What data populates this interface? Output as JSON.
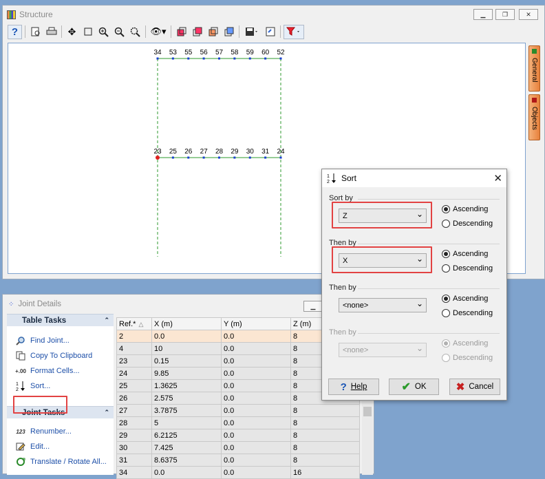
{
  "structure": {
    "title": "Structure",
    "top_labels": [
      "34",
      "53",
      "55",
      "56",
      "57",
      "58",
      "59",
      "60",
      "52"
    ],
    "mid_labels": [
      "23",
      "25",
      "26",
      "27",
      "28",
      "29",
      "30",
      "31",
      "24"
    ],
    "side_tabs": [
      "General",
      "Objects"
    ]
  },
  "joint": {
    "title": "Joint Details",
    "table_tasks_header": "Table Tasks",
    "table_tasks": [
      {
        "label": "Find Joint...",
        "icon": "magnifier-icon"
      },
      {
        "label": "Copy To Clipboard",
        "icon": "copy-icon"
      },
      {
        "label": "Format Cells...",
        "icon": "format-cells-icon"
      },
      {
        "label": "Sort...",
        "icon": "sort-icon"
      }
    ],
    "joint_tasks_header": "Joint Tasks",
    "joint_tasks": [
      {
        "label": "Renumber...",
        "icon": "renumber-icon"
      },
      {
        "label": "Edit...",
        "icon": "edit-icon"
      },
      {
        "label": "Translate / Rotate All...",
        "icon": "translate-icon"
      }
    ],
    "columns": [
      "Ref.*",
      "X (m)",
      "Y (m)",
      "Z (m)"
    ],
    "rows": [
      [
        "2",
        "0.0",
        "0.0",
        "8"
      ],
      [
        "4",
        "10",
        "0.0",
        "8"
      ],
      [
        "23",
        "0.15",
        "0.0",
        "8"
      ],
      [
        "24",
        "9.85",
        "0.0",
        "8"
      ],
      [
        "25",
        "1.3625",
        "0.0",
        "8"
      ],
      [
        "26",
        "2.575",
        "0.0",
        "8"
      ],
      [
        "27",
        "3.7875",
        "0.0",
        "8"
      ],
      [
        "28",
        "5",
        "0.0",
        "8"
      ],
      [
        "29",
        "6.2125",
        "0.0",
        "8"
      ],
      [
        "30",
        "7.425",
        "0.0",
        "8"
      ],
      [
        "31",
        "8.6375",
        "0.0",
        "8"
      ],
      [
        "34",
        "0.0",
        "0.0",
        "16"
      ]
    ]
  },
  "dialog": {
    "title": "Sort",
    "groups": [
      {
        "label": "Sort by",
        "value": "Z",
        "order": "Ascending",
        "disabled": false
      },
      {
        "label": "Then by",
        "value": "X",
        "order": "Ascending",
        "disabled": false
      },
      {
        "label": "Then by",
        "value": "<none>",
        "order": "Ascending",
        "disabled": false
      },
      {
        "label": "Then by",
        "value": "<none>",
        "order": "Ascending",
        "disabled": true
      }
    ],
    "ascending": "Ascending",
    "descending": "Descending",
    "help": "Help",
    "ok": "OK",
    "cancel": "Cancel"
  },
  "colors": {
    "highlight": "#e24242",
    "selected_row": "#fbe6d2",
    "link": "#1d4fa8",
    "beam": "#2e9a2e",
    "node": "#1a3fd1"
  }
}
